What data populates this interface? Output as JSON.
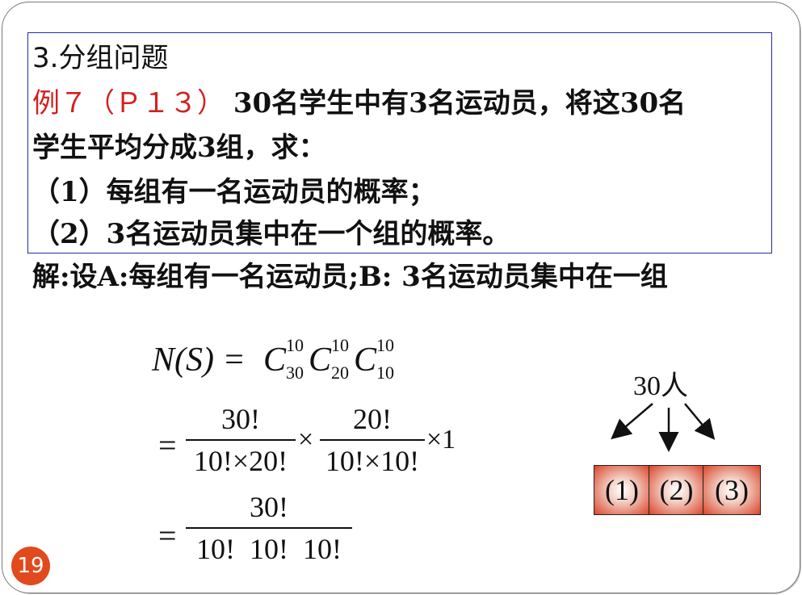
{
  "slide": {
    "section_title": "3.分组问题",
    "example_label": "例７（Ｐ１３）",
    "problem_line1": "30名学生中有3名运动员，将这30名",
    "problem_line2": "学生平均分成3组，求：",
    "question1": "（1）每组有一名运动员的概率；",
    "question2": "（2）3名运动员集中在一个组的概率。",
    "solution_line": "解:设A:每组有一名运动员;B: 3名运动员集中在一组",
    "page_number": "19"
  },
  "formula": {
    "ns_lhs": "N(S) =",
    "c1": "C",
    "c1_sup": "10",
    "c1_sub": "30",
    "c2": "C",
    "c2_sup": "10",
    "c2_sub": "20",
    "c3": "C",
    "c3_sup": "10",
    "c3_sub": "10",
    "eq1": "=",
    "frac1_num": "30!",
    "frac1_den": "10!×20!",
    "times1": "×",
    "frac2_num": "20!",
    "frac2_den": "10!×10!",
    "times2": "×1",
    "eq2": "=",
    "frac3_num": "30!",
    "frac3_den": "10!  10!  10!"
  },
  "diagram": {
    "total_label": "30人",
    "groups": [
      "(1)",
      "(2)",
      "(3)"
    ],
    "group_color": "#d9452a"
  }
}
